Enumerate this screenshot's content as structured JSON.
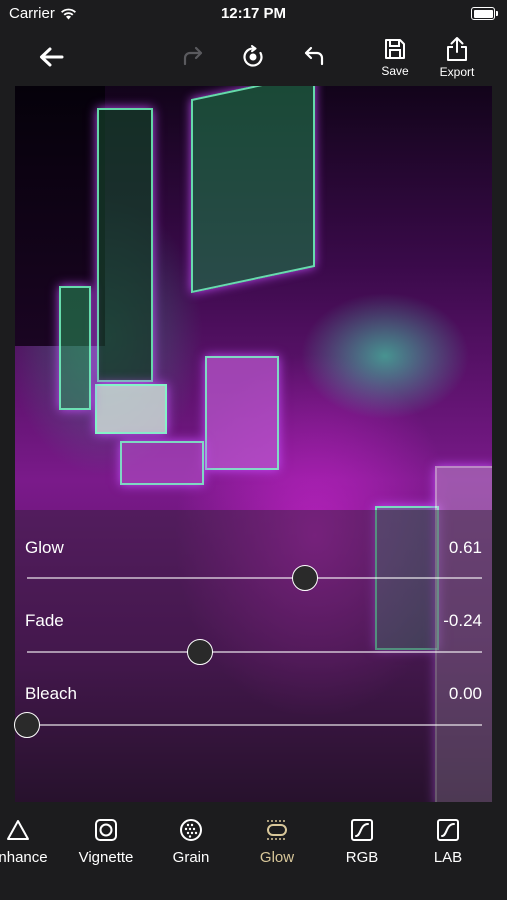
{
  "status": {
    "carrier": "Carrier",
    "time": "12:17 PM"
  },
  "toolbar": {
    "save_label": "Save",
    "export_label": "Export"
  },
  "sliders": [
    {
      "label": "Glow",
      "value_text": "0.61",
      "fraction": 0.61
    },
    {
      "label": "Fade",
      "value_text": "-0.24",
      "fraction": 0.38
    },
    {
      "label": "Bleach",
      "value_text": "0.00",
      "fraction": 0.0
    }
  ],
  "tabs": [
    {
      "label": "Enhance",
      "icon": "triangle-icon"
    },
    {
      "label": "Vignette",
      "icon": "vignette-icon"
    },
    {
      "label": "Grain",
      "icon": "grain-icon"
    },
    {
      "label": "Glow",
      "icon": "glow-icon",
      "active": true
    },
    {
      "label": "RGB",
      "icon": "curve-icon"
    },
    {
      "label": "LAB",
      "icon": "curve-icon"
    }
  ],
  "colors": {
    "accent": "#d8c79a",
    "background": "#1c1c1e"
  }
}
